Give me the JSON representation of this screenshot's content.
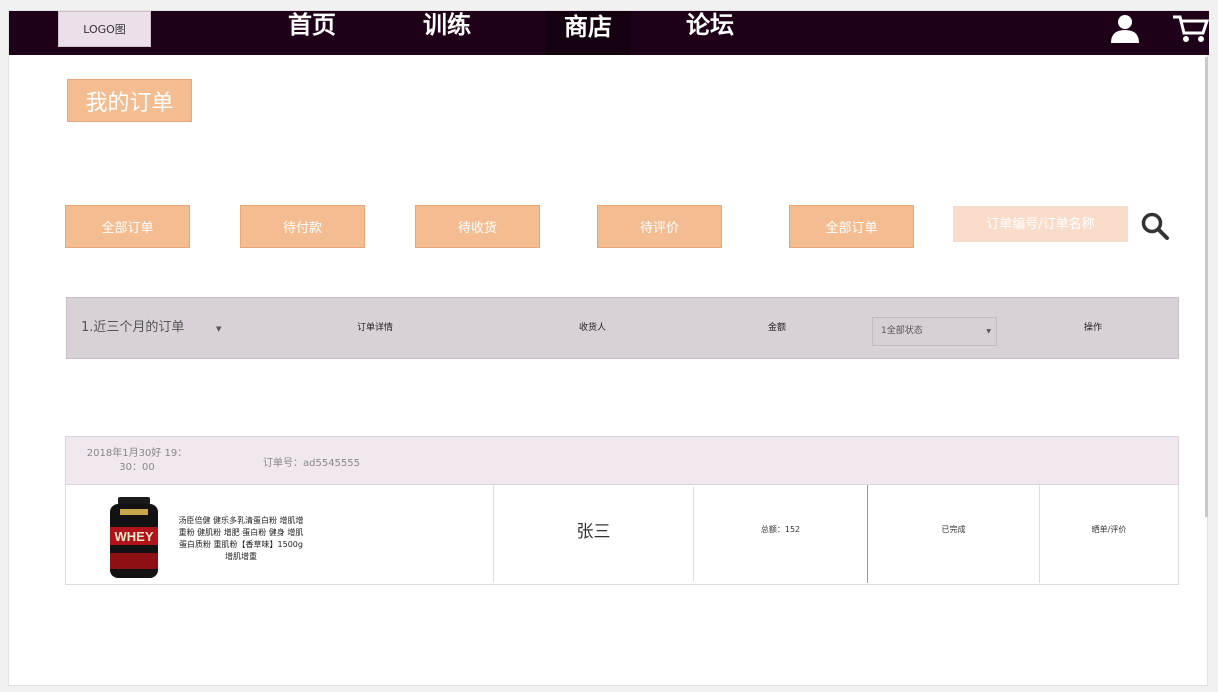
{
  "nav": {
    "logo": "LOGO图",
    "items": [
      "首页",
      "训练",
      "商店",
      "论坛"
    ]
  },
  "page_title": "我的订单",
  "tabs": [
    "全部订单",
    "待付款",
    "待收货",
    "待评价",
    "全部订单"
  ],
  "search": {
    "placeholder": "订单编号/订单名称"
  },
  "list_header": {
    "period": "1.近三个月的订单",
    "detail": "订单详情",
    "receiver": "收货人",
    "amount": "金额",
    "status_select": "1全部状态",
    "ops": "操作"
  },
  "order": {
    "date": "2018年1月30好 19：30：00",
    "number": "订单号：ad5545555",
    "product_name": "汤臣倍健 健乐多乳清蛋白粉 增肌增重粉 健肌粉 增肥 蛋白粉 健身 增肌 蛋白质粉 重肌粉【香草味】1500g 增肌增重",
    "receiver": "张三",
    "amount": "总额：152",
    "status": "已完成",
    "action": "晒单/评价"
  },
  "colors": {
    "nav_bg": "#1e0018",
    "accent": "#f4bd91",
    "header_bar": "#d9d1d8",
    "order_head": "#f0e7ef"
  }
}
